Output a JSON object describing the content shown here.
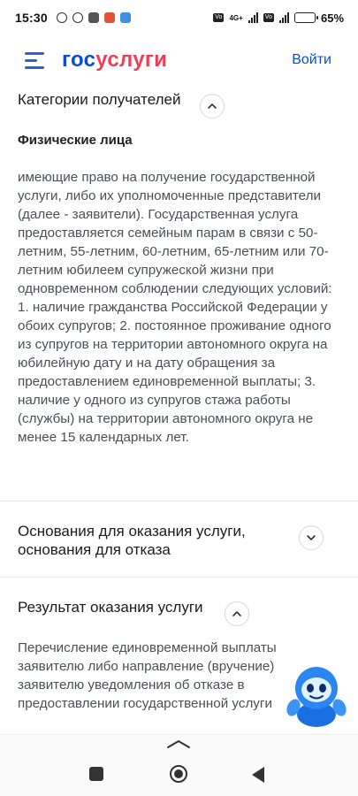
{
  "status_bar": {
    "time": "15:30",
    "network": "4G+",
    "battery_percent": "65",
    "battery_suffix": "%"
  },
  "header": {
    "logo_part1": "гос",
    "logo_part2": "услуги",
    "login_label": "Войти"
  },
  "sections": {
    "recipients": {
      "title": "Категории получателей",
      "subheading": "Физические лица",
      "text": "имеющие право на получение государственной услуги, либо их уполномоченные представители (далее - заявители). Государственная услуга предоставляется семейным парам в связи с 50-летним, 55-летним, 60-летним, 65-летним или 70-летним юбилеем супружеской жизни при одновременном соблюдении следующих условий: 1. наличие гражданства Российской Федерации у обоих супругов; 2. постоянное проживание одного из супругов на территории автономного округа на юбилейную дату и на дату обращения за предоставлением единовременной выплаты; 3. наличие у одного из супругов стажа работы (службы) на территории автономного округа не менее 15 календарных лет."
    },
    "grounds": {
      "title_line1": "Основания для оказания услуги,",
      "title_line2": "основания для отказа"
    },
    "result": {
      "title": "Результат оказания услуги",
      "text": "Перечисление единовременной выплаты заявителю либо направление (вручение) заявителю уведомления об отказе в предоставлении государственной услуги"
    }
  },
  "icons": {
    "menu": "hamburger-icon",
    "chevron_up": "chevron-up-icon",
    "chevron_down": "chevron-down-icon",
    "assistant": "robot-assistant-icon"
  },
  "colors": {
    "brand_blue": "#0d4cd3",
    "brand_red": "#ee3f58",
    "battery": "#f5a623"
  }
}
